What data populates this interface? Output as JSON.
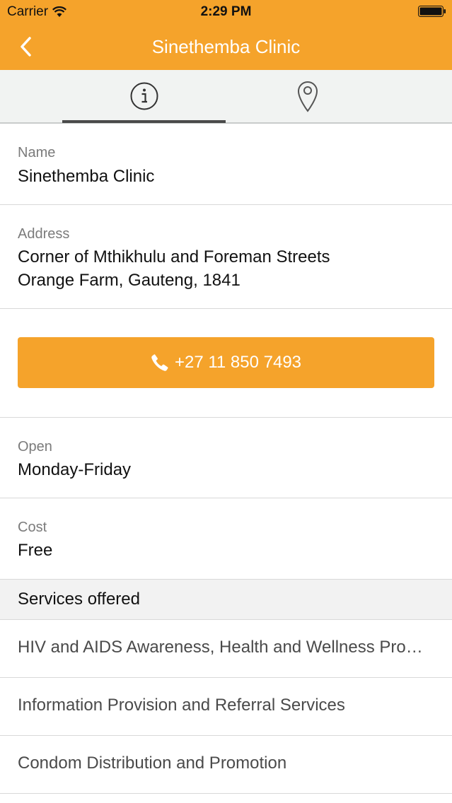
{
  "status_bar": {
    "carrier": "Carrier",
    "time": "2:29 PM",
    "icons": [
      "wifi-icon",
      "battery-icon"
    ]
  },
  "nav": {
    "title": "Sinethemba Clinic",
    "back_icon": "chevron-left-icon"
  },
  "tabs": [
    {
      "icon": "info-icon",
      "selected": true
    },
    {
      "icon": "map-pin-icon",
      "selected": false
    }
  ],
  "details": {
    "name": {
      "label": "Name",
      "value": "Sinethemba Clinic"
    },
    "address": {
      "label": "Address",
      "line1": "Corner of Mthikhulu and Foreman Streets",
      "line2": "Orange Farm, Gauteng, 1841"
    },
    "phone": {
      "icon": "phone-icon",
      "value": "+27 11 850 7493"
    },
    "open": {
      "label": "Open",
      "value": "Monday-Friday"
    },
    "cost": {
      "label": "Cost",
      "value": "Free"
    }
  },
  "services": {
    "header": "Services offered",
    "items": [
      "HIV and AIDS Awareness, Health and Wellness Pro…",
      "Information Provision and Referral Services",
      "Condom Distribution and Promotion"
    ]
  },
  "colors": {
    "accent": "#f5a32b",
    "tab_background": "#f1f3f2",
    "section_background": "#f2f2f2",
    "label_text": "#7b7b7b",
    "divider": "#d9d9d9"
  }
}
